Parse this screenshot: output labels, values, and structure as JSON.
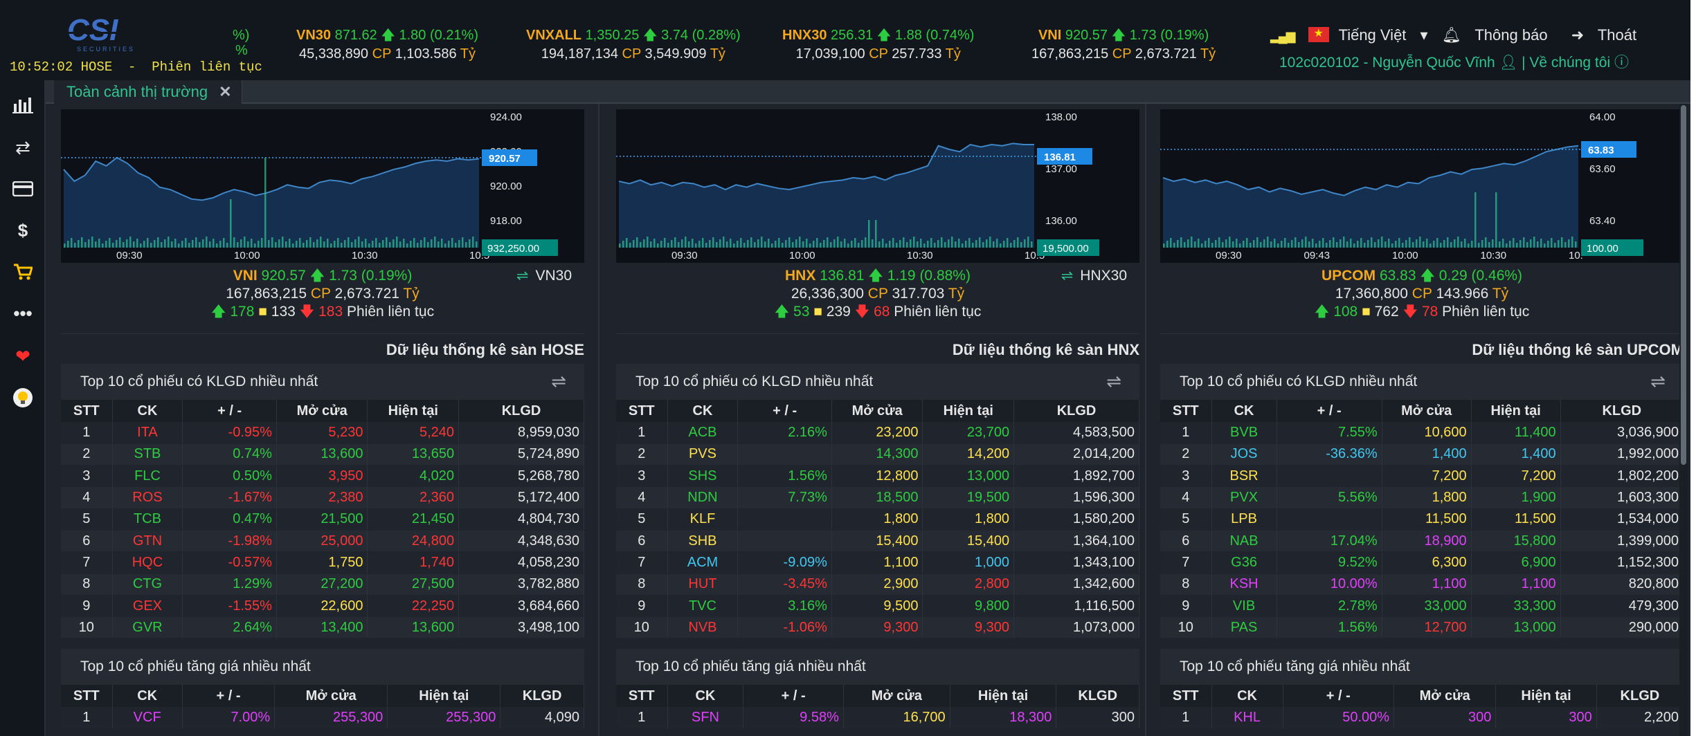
{
  "header": {
    "logo_text": "CSI",
    "logo_sub": "SECURITIES",
    "clock": "10:52:02 HOSE  -  Phiên liên tục",
    "frag1": "%)",
    "frag2": "%",
    "indices": [
      {
        "name": "VN30",
        "value": "871.62",
        "change": "1.80",
        "pct": "(0.21%)",
        "volume": "45,338,890",
        "value_label": "1,103.586"
      },
      {
        "name": "VNXALL",
        "value": "1,350.25",
        "change": "3.74",
        "pct": "(0.28%)",
        "volume": "194,187,134",
        "value_label": "3,549.909"
      },
      {
        "name": "HNX30",
        "value": "256.31",
        "change": "1.88",
        "pct": "(0.74%)",
        "volume": "17,039,100",
        "value_label": "257.733"
      },
      {
        "name": "VNI",
        "value": "920.57",
        "change": "1.73",
        "pct": "(0.19%)",
        "volume": "167,863,215",
        "value_label": "2,673.721"
      }
    ],
    "cp": "CP",
    "ty": "Tỷ",
    "language": "Tiếng Việt",
    "notify": "Thông báo",
    "logout": "Thoát",
    "account": "102c020102 - Nguyễn Quốc Vĩnh",
    "about": "Về chúng tôi"
  },
  "sidebar": {
    "icons": [
      "chart-icon",
      "transfer-icon",
      "card-icon",
      "dollar-icon",
      "cart-icon",
      "more-icon",
      "heart-icon",
      "bulb-icon"
    ]
  },
  "tab": {
    "label": "Toàn cảnh thị trường"
  },
  "panels": [
    {
      "index": "VNI",
      "value": "920.57",
      "change": "1.73",
      "pct": "(0.19%)",
      "volume": "167,863,215",
      "trade_value": "2,673.721",
      "advances": "178",
      "unchanged": "133",
      "declines": "183",
      "session": "Phiên liên tục",
      "switch_label": "VN30",
      "stat_title": "Dữ liệu thống kê sàn HOSE",
      "chart": {
        "y_ticks": [
          "924.00",
          "922.00",
          "920.00",
          "918.00"
        ],
        "x_ticks": [
          "09:30",
          "10:00",
          "10:30",
          "10:5"
        ],
        "price_tag": "920.57",
        "vol_tag": "932,250.00"
      },
      "top_volume": [
        [
          "1",
          "ITA",
          "-0.95%",
          "5,230",
          "5,240",
          "8,959,030",
          "dn",
          "dn",
          "dn"
        ],
        [
          "2",
          "STB",
          "0.74%",
          "13,600",
          "13,650",
          "5,724,890",
          "up",
          "up",
          "up"
        ],
        [
          "3",
          "FLC",
          "0.50%",
          "3,950",
          "4,020",
          "5,268,780",
          "up",
          "dn",
          "up"
        ],
        [
          "4",
          "ROS",
          "-1.67%",
          "2,380",
          "2,360",
          "5,172,400",
          "dn",
          "dn",
          "dn"
        ],
        [
          "5",
          "TCB",
          "0.47%",
          "21,500",
          "21,450",
          "4,804,730",
          "up",
          "up",
          "up"
        ],
        [
          "6",
          "GTN",
          "-1.98%",
          "25,000",
          "24,800",
          "4,348,630",
          "dn",
          "dn",
          "dn"
        ],
        [
          "7",
          "HQC",
          "-0.57%",
          "1,750",
          "1,740",
          "4,058,230",
          "dn",
          "ylw",
          "dn"
        ],
        [
          "8",
          "CTG",
          "1.29%",
          "27,200",
          "27,500",
          "3,782,880",
          "up",
          "up",
          "up"
        ],
        [
          "9",
          "GEX",
          "-1.55%",
          "22,600",
          "22,250",
          "3,684,660",
          "dn",
          "ylw",
          "dn"
        ],
        [
          "10",
          "GVR",
          "2.64%",
          "13,400",
          "13,600",
          "3,498,100",
          "up",
          "up",
          "up"
        ]
      ],
      "top_gain": [
        [
          "1",
          "VCF",
          "7.00%",
          "255,300",
          "255,300",
          "4,090",
          "pur",
          "pur",
          "pur"
        ]
      ]
    },
    {
      "index": "HNX",
      "value": "136.81",
      "change": "1.19",
      "pct": "(0.88%)",
      "volume": "26,336,300",
      "trade_value": "317.703",
      "advances": "53",
      "unchanged": "239",
      "declines": "68",
      "session": "Phiên liên tục",
      "switch_label": "HNX30",
      "stat_title": "Dữ liệu thống kê sàn HNX",
      "chart": {
        "y_ticks": [
          "138.00",
          "137.00",
          "136.00"
        ],
        "x_ticks": [
          "09:30",
          "10:00",
          "10:30",
          "10:5"
        ],
        "price_tag": "136.81",
        "vol_tag": "19,500.00"
      },
      "top_volume": [
        [
          "1",
          "ACB",
          "2.16%",
          "23,200",
          "23,700",
          "4,583,500",
          "up",
          "ylw",
          "up"
        ],
        [
          "2",
          "PVS",
          "",
          "14,300",
          "14,200",
          "2,014,200",
          "ylw",
          "up",
          "ylw"
        ],
        [
          "3",
          "SHS",
          "1.56%",
          "12,800",
          "13,000",
          "1,892,700",
          "up",
          "ylw",
          "up"
        ],
        [
          "4",
          "NDN",
          "7.73%",
          "18,500",
          "19,500",
          "1,596,300",
          "up",
          "up",
          "up"
        ],
        [
          "5",
          "KLF",
          "",
          "1,800",
          "1,800",
          "1,580,200",
          "ylw",
          "ylw",
          "ylw"
        ],
        [
          "6",
          "SHB",
          "",
          "15,400",
          "15,400",
          "1,364,100",
          "ylw",
          "ylw",
          "ylw"
        ],
        [
          "7",
          "ACM",
          "-9.09%",
          "1,100",
          "1,000",
          "1,343,100",
          "cyn",
          "ylw",
          "cyn"
        ],
        [
          "8",
          "HUT",
          "-3.45%",
          "2,900",
          "2,800",
          "1,342,600",
          "dn",
          "ylw",
          "dn"
        ],
        [
          "9",
          "TVC",
          "3.16%",
          "9,500",
          "9,800",
          "1,116,500",
          "up",
          "ylw",
          "up"
        ],
        [
          "10",
          "NVB",
          "-1.06%",
          "9,300",
          "9,300",
          "1,073,000",
          "dn",
          "dn",
          "dn"
        ]
      ],
      "top_gain": [
        [
          "1",
          "SFN",
          "9.58%",
          "16,700",
          "18,300",
          "300",
          "pur",
          "ylw",
          "pur"
        ]
      ]
    },
    {
      "index": "UPCOM",
      "value": "63.83",
      "change": "0.29",
      "pct": "(0.46%)",
      "volume": "17,360,800",
      "trade_value": "143.966",
      "advances": "108",
      "unchanged": "762",
      "declines": "78",
      "session": "Phiên liên tục",
      "switch_label": "",
      "stat_title": "Dữ liệu thống kê sàn UPCOM",
      "chart": {
        "y_ticks": [
          "64.00",
          "63.60",
          "63.40"
        ],
        "x_ticks": [
          "09:30",
          "09:43",
          "10:00",
          "10:30",
          "10:"
        ],
        "price_tag": "63.83",
        "vol_tag": "100.00"
      },
      "top_volume": [
        [
          "1",
          "BVB",
          "7.55%",
          "10,600",
          "11,400",
          "3,036,900",
          "up",
          "ylw",
          "up"
        ],
        [
          "2",
          "JOS",
          "-36.36%",
          "1,400",
          "1,400",
          "1,992,000",
          "cyn",
          "cyn",
          "cyn"
        ],
        [
          "3",
          "BSR",
          "",
          "7,200",
          "7,200",
          "1,802,200",
          "ylw",
          "ylw",
          "ylw"
        ],
        [
          "4",
          "PVX",
          "5.56%",
          "1,800",
          "1,900",
          "1,603,300",
          "up",
          "ylw",
          "up"
        ],
        [
          "5",
          "LPB",
          "",
          "11,500",
          "11,500",
          "1,534,000",
          "ylw",
          "ylw",
          "ylw"
        ],
        [
          "6",
          "NAB",
          "17.04%",
          "18,900",
          "15,800",
          "1,399,000",
          "up",
          "pur",
          "up"
        ],
        [
          "7",
          "G36",
          "9.52%",
          "6,300",
          "6,900",
          "1,152,300",
          "up",
          "ylw",
          "up"
        ],
        [
          "8",
          "KSH",
          "10.00%",
          "1,100",
          "1,100",
          "820,800",
          "pur",
          "pur",
          "pur"
        ],
        [
          "9",
          "VIB",
          "2.78%",
          "33,000",
          "33,300",
          "479,300",
          "up",
          "up",
          "up"
        ],
        [
          "10",
          "PAS",
          "1.56%",
          "12,700",
          "13,000",
          "290,000",
          "up",
          "dn",
          "up"
        ]
      ],
      "top_gain": [
        [
          "1",
          "KHL",
          "50.00%",
          "300",
          "300",
          "2,200",
          "pur",
          "pur",
          "pur"
        ]
      ]
    }
  ],
  "table_headers": [
    "STT",
    "CK",
    "+ / -",
    "Mở cửa",
    "Hiện tại",
    "KLGD"
  ],
  "section_titles": {
    "top_volume": "Top 10 cổ phiếu có KLGD nhiều nhất",
    "top_gain": "Top 10 cổ phiếu tăng giá nhiều nhất"
  },
  "colors": {
    "up": "#2ecc40",
    "down": "#ff3535",
    "ref": "#f4a81d",
    "accent": "#2fc48f",
    "bg": "#1f242c"
  }
}
